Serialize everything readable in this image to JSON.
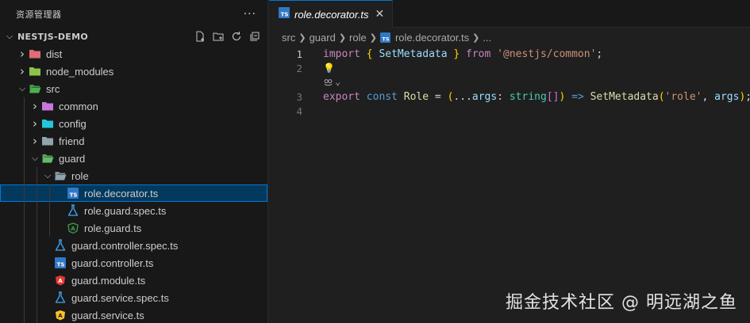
{
  "explorer": {
    "title": "资源管理器",
    "more": "···",
    "project": "NESTJS-DEMO",
    "actions": [
      {
        "name": "new-file-icon",
        "glyph": "🗋"
      },
      {
        "name": "new-folder-icon",
        "glyph": "🗀"
      },
      {
        "name": "refresh-icon",
        "glyph": "↻"
      },
      {
        "name": "collapse-all-icon",
        "glyph": "⧉"
      }
    ],
    "tree": [
      {
        "label": "dist",
        "depth": 0,
        "kind": "folder",
        "expanded": false,
        "color": "#e06c75"
      },
      {
        "label": "node_modules",
        "depth": 0,
        "kind": "folder",
        "expanded": false,
        "color": "#8bc34a"
      },
      {
        "label": "src",
        "depth": 0,
        "kind": "folder",
        "expanded": true,
        "color": "#4caf50"
      },
      {
        "label": "common",
        "depth": 1,
        "kind": "folder",
        "expanded": false,
        "color": "#c678dd"
      },
      {
        "label": "config",
        "depth": 1,
        "kind": "folder",
        "expanded": false,
        "color": "#26c6da"
      },
      {
        "label": "friend",
        "depth": 1,
        "kind": "folder",
        "expanded": false,
        "color": "#90a4ae"
      },
      {
        "label": "guard",
        "depth": 1,
        "kind": "folder",
        "expanded": true,
        "color": "#66bb6a"
      },
      {
        "label": "role",
        "depth": 2,
        "kind": "folder",
        "expanded": true,
        "color": "#90a4ae"
      },
      {
        "label": "role.decorator.ts",
        "depth": 3,
        "kind": "ts",
        "selected": true
      },
      {
        "label": "role.guard.spec.ts",
        "depth": 3,
        "kind": "spec"
      },
      {
        "label": "role.guard.ts",
        "depth": 3,
        "kind": "nest-guard"
      },
      {
        "label": "guard.controller.spec.ts",
        "depth": 2,
        "kind": "spec"
      },
      {
        "label": "guard.controller.ts",
        "depth": 2,
        "kind": "ts"
      },
      {
        "label": "guard.module.ts",
        "depth": 2,
        "kind": "nest-module"
      },
      {
        "label": "guard.service.spec.ts",
        "depth": 2,
        "kind": "spec"
      },
      {
        "label": "guard.service.ts",
        "depth": 2,
        "kind": "nest-service"
      }
    ]
  },
  "editor": {
    "tab": {
      "label": "role.decorator.ts",
      "close": "✕"
    },
    "breadcrumbs": [
      "src",
      "guard",
      "role",
      "role.decorator.ts",
      "..."
    ],
    "line_numbers": [
      "1",
      "2",
      "3",
      "4"
    ],
    "code": {
      "l1": {
        "import": "import",
        "lb": "{",
        "name": "SetMetadata",
        "rb": "}",
        "from": "from",
        "str": "'@nestjs/common'",
        "semi": ";"
      },
      "l3": {
        "export": "export",
        "const": "const",
        "name": "Role",
        "eq": "=",
        "lp": "(",
        "spread": "...",
        "arg": "args",
        "colon": ":",
        "type": "string",
        "brackets": "[]",
        "rp": ")",
        "arrow": "=>",
        "fn": "SetMetadata",
        "lp2": "(",
        "str": "'role'",
        "comma": ",",
        "arg2": "args",
        "rp2": ")",
        "semi": ";"
      }
    },
    "lightbulb": "💡",
    "codelens": "⌄"
  },
  "watermark": "掘金技术社区 @ 明远湖之鱼",
  "colors": {
    "accent": "#0078d4",
    "selected_bg": "#04395e",
    "ts_blue": "#3178c6"
  }
}
